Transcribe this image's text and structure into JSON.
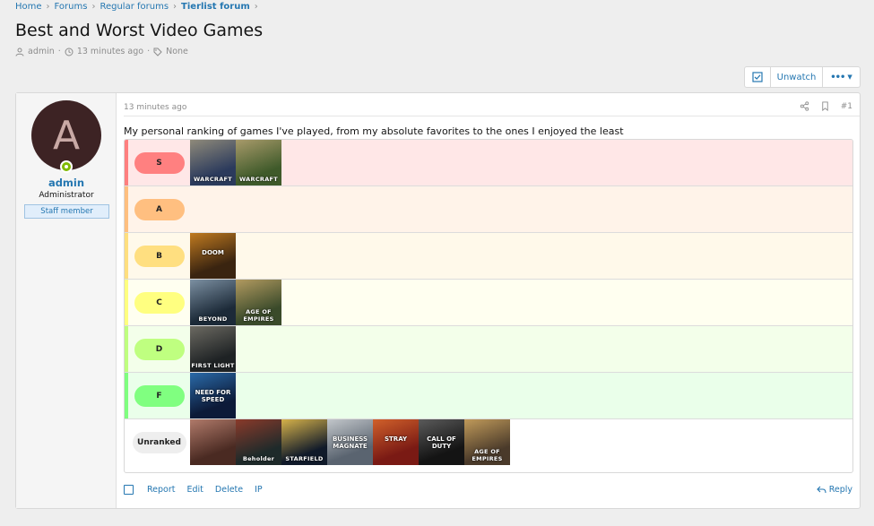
{
  "breadcrumb": [
    {
      "label": "Home"
    },
    {
      "label": "Forums"
    },
    {
      "label": "Regular forums"
    },
    {
      "label": "Tierlist forum"
    }
  ],
  "thread": {
    "title": "Best and Worst Video Games",
    "author": "admin",
    "time": "13 minutes ago",
    "tags": "None"
  },
  "toolbar": {
    "unwatch_label": "Unwatch",
    "more_label": "•••"
  },
  "user": {
    "avatar_letter": "A",
    "name": "admin",
    "title": "Administrator",
    "banner": "Staff member"
  },
  "post": {
    "time": "13 minutes ago",
    "number": "#1",
    "text": "My personal ranking of games I've played, from my absolute favorites to the ones I enjoyed the least"
  },
  "tiers": [
    {
      "label": "S",
      "pill": "#ff8080",
      "stripe": "#ff7f7f",
      "bg": "#ffe7e7",
      "items": [
        {
          "name": "warcraft-cover",
          "c1": "#2b3a5c",
          "c2": "#8f8a7a",
          "text": "WARCRAFT"
        },
        {
          "name": "warcraft-orc-cover",
          "c1": "#3f5a2a",
          "c2": "#a89a6a",
          "text": "WARCRAFT"
        }
      ]
    },
    {
      "label": "A",
      "pill": "#ffbf80",
      "stripe": "#ffbf7f",
      "bg": "#fff3e9",
      "items": []
    },
    {
      "label": "B",
      "pill": "#ffdf80",
      "stripe": "#ffdf7f",
      "bg": "#fff9ea",
      "items": [
        {
          "name": "doom-cover",
          "c1": "#3a2410",
          "c2": "#c07a20",
          "text": "DOOM",
          "mid": true
        }
      ]
    },
    {
      "label": "C",
      "pill": "#ffff80",
      "stripe": "#ffff7f",
      "bg": "#fffff0",
      "items": [
        {
          "name": "beyond-cover",
          "c1": "#1c2a38",
          "c2": "#7c90a2",
          "text": "BEYOND"
        },
        {
          "name": "age-of-empires-cover",
          "c1": "#3a4a2a",
          "c2": "#b29a60",
          "text": "AGE OF EMPIRES"
        }
      ]
    },
    {
      "label": "D",
      "pill": "#bfff80",
      "stripe": "#bfff7f",
      "bg": "#f3ffea",
      "items": [
        {
          "name": "first-light-cover",
          "c1": "#1e2224",
          "c2": "#6c6a62",
          "text": "FIRST LIGHT"
        }
      ]
    },
    {
      "label": "F",
      "pill": "#80ff80",
      "stripe": "#7fff7f",
      "bg": "#eaffea",
      "items": [
        {
          "name": "need-for-speed-cover",
          "c1": "#0c1a38",
          "c2": "#2a6aa8",
          "text": "NEED FOR SPEED",
          "mid": true
        }
      ]
    },
    {
      "label": "Unranked",
      "pill": "#eeeeee",
      "stripe": "#ffffff",
      "bg": "#ffffff",
      "items": [
        {
          "name": "war-cover",
          "c1": "#4a2a22",
          "c2": "#b07a6a",
          "text": ""
        },
        {
          "name": "beholder-cover",
          "c1": "#1e2a2a",
          "c2": "#8a3a2a",
          "text": "Beholder"
        },
        {
          "name": "starfield-cover",
          "c1": "#101a2a",
          "c2": "#d6b24a",
          "text": "STARFIELD"
        },
        {
          "name": "business-magnate-cover",
          "c1": "#5a6470",
          "c2": "#c2c6ca",
          "text": "BUSINESS MAGNATE",
          "mid": true
        },
        {
          "name": "stray-cover",
          "c1": "#7a1a14",
          "c2": "#d0602a",
          "text": "STRAY",
          "mid": true
        },
        {
          "name": "call-of-duty-cover",
          "c1": "#141414",
          "c2": "#5a5a5a",
          "text": "CALL OF DUTY",
          "mid": true
        },
        {
          "name": "age-of-empires-2-cover",
          "c1": "#4a3a2a",
          "c2": "#c09a5a",
          "text": "AGE OF EMPIRES"
        }
      ]
    }
  ],
  "actions": {
    "report": "Report",
    "edit": "Edit",
    "delete": "Delete",
    "ip": "IP",
    "reply": "Reply"
  }
}
